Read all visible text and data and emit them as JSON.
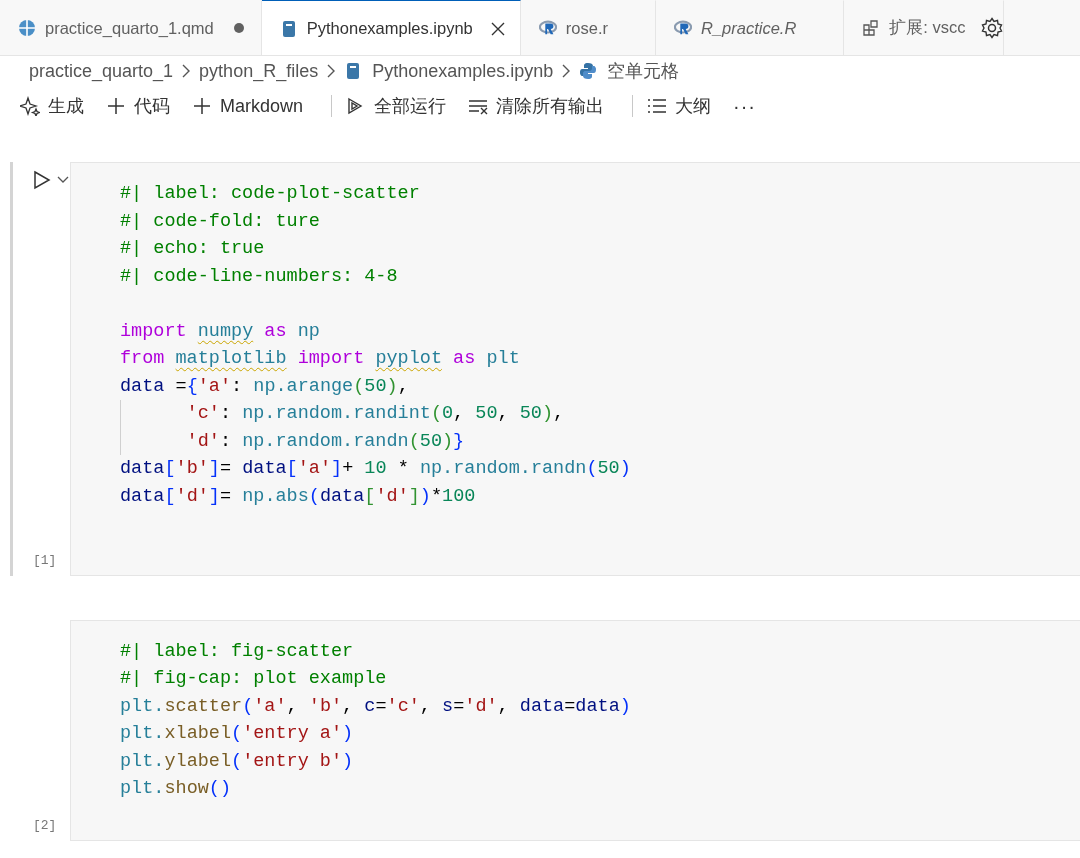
{
  "tabs": [
    {
      "kind": "quarto",
      "label": "practice_quarto_1.qmd",
      "selected": false,
      "modified": true,
      "italic": false
    },
    {
      "kind": "notebook",
      "label": "Pythonexamples.ipynb",
      "selected": true,
      "modified": false,
      "italic": false
    },
    {
      "kind": "r",
      "label": "rose.r",
      "selected": false,
      "modified": false,
      "italic": false
    },
    {
      "kind": "r",
      "label": "R_practice.R",
      "selected": false,
      "modified": false,
      "italic": true
    },
    {
      "kind": "extension",
      "label": "扩展: vscc",
      "selected": false,
      "modified": false,
      "italic": false
    }
  ],
  "breadcrumbs": [
    {
      "kind": "folder",
      "label": "practice_quarto_1"
    },
    {
      "kind": "folder",
      "label": "python_R_files"
    },
    {
      "kind": "notebook",
      "label": "Pythonexamples.ipynb"
    },
    {
      "kind": "python",
      "label": "空单元格"
    }
  ],
  "toolbar": [
    {
      "kind": "generate",
      "label": "生成"
    },
    {
      "kind": "add",
      "label": "代码"
    },
    {
      "kind": "add",
      "label": "Markdown"
    },
    {
      "kind": "separator"
    },
    {
      "kind": "run-all",
      "label": "全部运行"
    },
    {
      "kind": "clear",
      "label": "清除所有输出"
    },
    {
      "kind": "separator"
    },
    {
      "kind": "outline",
      "label": "大纲"
    },
    {
      "kind": "more",
      "label": "···"
    }
  ],
  "cells": [
    {
      "focused": true,
      "execution_count": "[1]",
      "lines": [
        {
          "tokens": [
            {
              "kind": "comment",
              "text": "#| label: code-plot-scatter"
            }
          ]
        },
        {
          "tokens": [
            {
              "kind": "comment",
              "text": "#| code-fold: ture"
            }
          ]
        },
        {
          "tokens": [
            {
              "kind": "comment",
              "text": "#| echo: true"
            }
          ]
        },
        {
          "tokens": [
            {
              "kind": "comment",
              "text": "#| code-line-numbers: 4-8"
            }
          ]
        },
        {
          "blank": true
        },
        {
          "tokens": [
            {
              "kind": "keyword",
              "text": "import "
            },
            {
              "kind": "module",
              "text": "numpy",
              "warning": true
            },
            {
              "kind": "keyword",
              "text": " as "
            },
            {
              "kind": "module",
              "text": "np"
            }
          ]
        },
        {
          "tokens": [
            {
              "kind": "keyword",
              "text": "from "
            },
            {
              "kind": "module",
              "text": "matplotlib",
              "warning": true
            },
            {
              "kind": "keyword",
              "text": " import "
            },
            {
              "kind": "module",
              "text": "pyplot",
              "warning": true
            },
            {
              "kind": "keyword",
              "text": " as "
            },
            {
              "kind": "module",
              "text": "plt"
            }
          ]
        },
        {
          "tokens": [
            {
              "kind": "variable",
              "text": "data"
            },
            {
              "kind": "plain",
              "text": " ="
            },
            {
              "kind": "bracket",
              "text": "{"
            },
            {
              "kind": "string",
              "text": "'a'"
            },
            {
              "kind": "plain",
              "text": ": "
            },
            {
              "kind": "module",
              "text": "np.arange"
            },
            {
              "kind": "bracket2",
              "text": "("
            },
            {
              "kind": "number",
              "text": "50"
            },
            {
              "kind": "bracket2",
              "text": ")"
            },
            {
              "kind": "plain",
              "text": ","
            }
          ]
        },
        {
          "guide": true,
          "tokens": [
            {
              "kind": "string",
              "text": "      'c'"
            },
            {
              "kind": "plain",
              "text": ": "
            },
            {
              "kind": "module",
              "text": "np.random.randint"
            },
            {
              "kind": "bracket2",
              "text": "("
            },
            {
              "kind": "number",
              "text": "0"
            },
            {
              "kind": "plain",
              "text": ", "
            },
            {
              "kind": "number",
              "text": "50"
            },
            {
              "kind": "plain",
              "text": ", "
            },
            {
              "kind": "number",
              "text": "50"
            },
            {
              "kind": "bracket2",
              "text": ")"
            },
            {
              "kind": "plain",
              "text": ","
            }
          ]
        },
        {
          "guide": true,
          "tokens": [
            {
              "kind": "string",
              "text": "      'd'"
            },
            {
              "kind": "plain",
              "text": ": "
            },
            {
              "kind": "module",
              "text": "np.random.randn"
            },
            {
              "kind": "bracket2",
              "text": "("
            },
            {
              "kind": "number",
              "text": "50"
            },
            {
              "kind": "bracket2",
              "text": ")"
            },
            {
              "kind": "bracket",
              "text": "}"
            }
          ]
        },
        {
          "tokens": [
            {
              "kind": "variable",
              "text": "data"
            },
            {
              "kind": "bracket",
              "text": "["
            },
            {
              "kind": "string",
              "text": "'b'"
            },
            {
              "kind": "bracket",
              "text": "]"
            },
            {
              "kind": "plain",
              "text": "= "
            },
            {
              "kind": "variable",
              "text": "data"
            },
            {
              "kind": "bracket",
              "text": "["
            },
            {
              "kind": "string",
              "text": "'a'"
            },
            {
              "kind": "bracket",
              "text": "]"
            },
            {
              "kind": "plain",
              "text": "+ "
            },
            {
              "kind": "number",
              "text": "10"
            },
            {
              "kind": "plain",
              "text": " * "
            },
            {
              "kind": "module",
              "text": "np.random.randn"
            },
            {
              "kind": "bracket",
              "text": "("
            },
            {
              "kind": "number",
              "text": "50"
            },
            {
              "kind": "bracket",
              "text": ")"
            }
          ]
        },
        {
          "tokens": [
            {
              "kind": "variable",
              "text": "data"
            },
            {
              "kind": "bracket",
              "text": "["
            },
            {
              "kind": "string",
              "text": "'d'"
            },
            {
              "kind": "bracket",
              "text": "]"
            },
            {
              "kind": "plain",
              "text": "= "
            },
            {
              "kind": "module",
              "text": "np.abs"
            },
            {
              "kind": "bracket",
              "text": "("
            },
            {
              "kind": "variable",
              "text": "data"
            },
            {
              "kind": "bracket2",
              "text": "["
            },
            {
              "kind": "string",
              "text": "'d'"
            },
            {
              "kind": "bracket2",
              "text": "]"
            },
            {
              "kind": "bracket",
              "text": ")"
            },
            {
              "kind": "plain",
              "text": "*"
            },
            {
              "kind": "number",
              "text": "100"
            }
          ]
        },
        {
          "blank": true
        }
      ]
    },
    {
      "focused": false,
      "execution_count": "[2]",
      "lines": [
        {
          "tokens": [
            {
              "kind": "comment",
              "text": "#| label: fig-scatter"
            }
          ]
        },
        {
          "tokens": [
            {
              "kind": "comment",
              "text": "#| fig-cap: plot example"
            }
          ]
        },
        {
          "tokens": [
            {
              "kind": "module",
              "text": "plt."
            },
            {
              "kind": "function",
              "text": "scatter"
            },
            {
              "kind": "bracket",
              "text": "("
            },
            {
              "kind": "string",
              "text": "'a'"
            },
            {
              "kind": "plain",
              "text": ", "
            },
            {
              "kind": "string",
              "text": "'b'"
            },
            {
              "kind": "plain",
              "text": ", "
            },
            {
              "kind": "variable",
              "text": "c"
            },
            {
              "kind": "plain",
              "text": "="
            },
            {
              "kind": "string",
              "text": "'c'"
            },
            {
              "kind": "plain",
              "text": ", "
            },
            {
              "kind": "variable",
              "text": "s"
            },
            {
              "kind": "plain",
              "text": "="
            },
            {
              "kind": "string",
              "text": "'d'"
            },
            {
              "kind": "plain",
              "text": ", "
            },
            {
              "kind": "variable",
              "text": "data"
            },
            {
              "kind": "plain",
              "text": "="
            },
            {
              "kind": "variable",
              "text": "data"
            },
            {
              "kind": "bracket",
              "text": ")"
            }
          ]
        },
        {
          "tokens": [
            {
              "kind": "module",
              "text": "plt."
            },
            {
              "kind": "function",
              "text": "xlabel"
            },
            {
              "kind": "bracket",
              "text": "("
            },
            {
              "kind": "string",
              "text": "'entry a'"
            },
            {
              "kind": "bracket",
              "text": ")"
            }
          ]
        },
        {
          "tokens": [
            {
              "kind": "module",
              "text": "plt."
            },
            {
              "kind": "function",
              "text": "ylabel"
            },
            {
              "kind": "bracket",
              "text": "("
            },
            {
              "kind": "string",
              "text": "'entry b'"
            },
            {
              "kind": "bracket",
              "text": ")"
            }
          ]
        },
        {
          "tokens": [
            {
              "kind": "module",
              "text": "plt."
            },
            {
              "kind": "function",
              "text": "show"
            },
            {
              "kind": "bracket",
              "text": "()"
            }
          ]
        }
      ]
    }
  ]
}
